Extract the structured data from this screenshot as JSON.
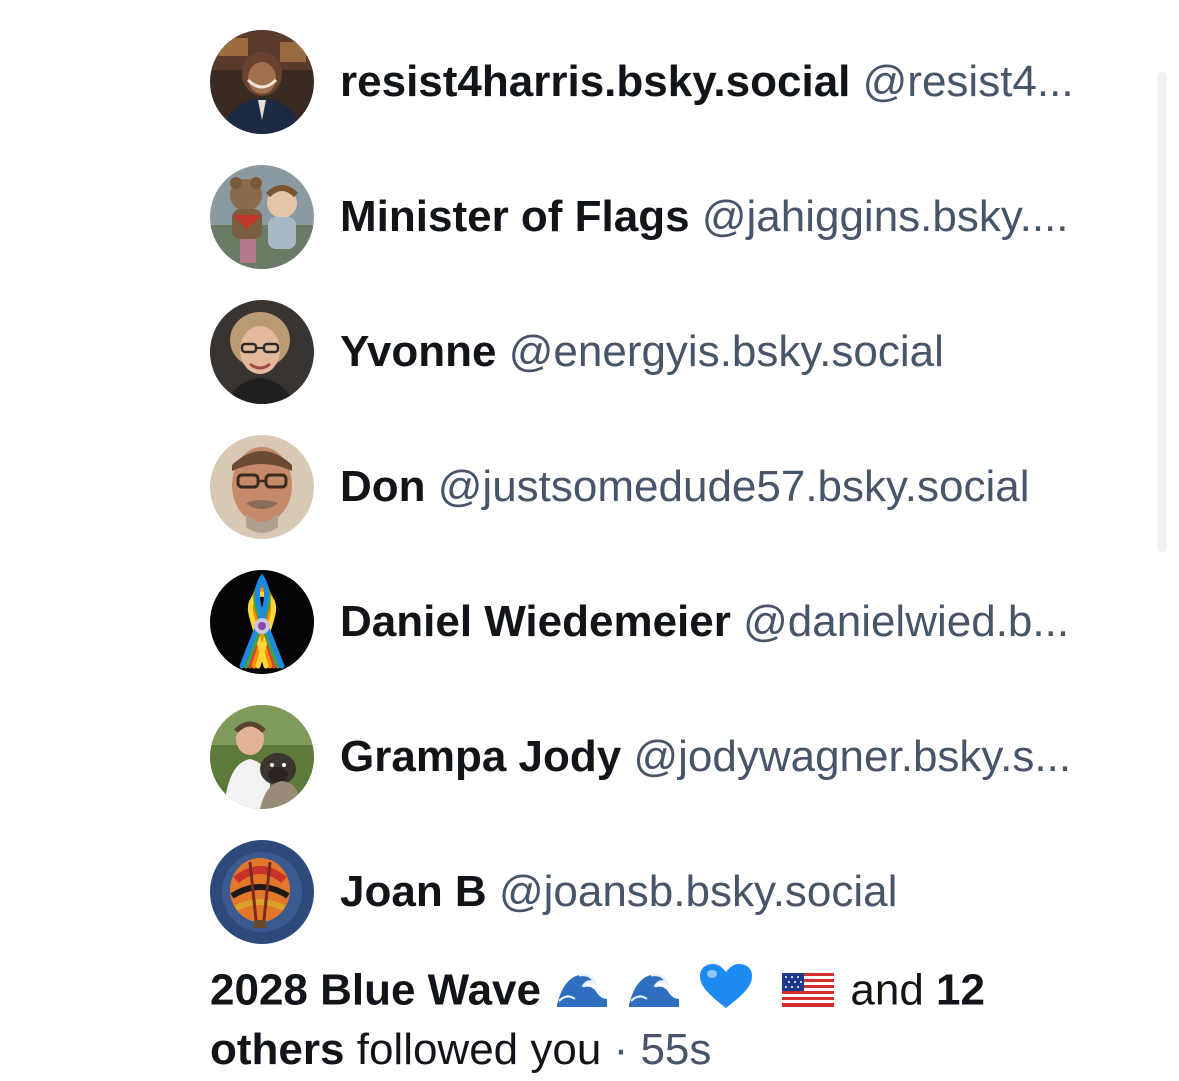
{
  "followers": [
    {
      "display_name": "resist4harris.bsky.social",
      "handle": "@resist4...",
      "avatar_icon": "portrait-woman-thank-you-avatar"
    },
    {
      "display_name": "Minister of Flags",
      "handle": "@jahiggins.bsky....",
      "avatar_icon": "plush-toys-avatar"
    },
    {
      "display_name": "Yvonne",
      "handle": "@energyis.bsky.social",
      "avatar_icon": "woman-glasses-avatar"
    },
    {
      "display_name": "Don",
      "handle": "@justsomedude57.bsky.social",
      "avatar_icon": "man-glasses-avatar"
    },
    {
      "display_name": "Daniel Wiedemeier",
      "handle": "@danielwied.b...",
      "avatar_icon": "rainbow-ribbon-avatar"
    },
    {
      "display_name": "Grampa Jody",
      "handle": "@jodywagner.bsky.s...",
      "avatar_icon": "man-with-dog-avatar"
    },
    {
      "display_name": "Joan B",
      "handle": "@joansb.bsky.social",
      "avatar_icon": "hot-air-balloon-avatar"
    }
  ],
  "summary": {
    "lead_name": "2028 Blue Wave",
    "lead_emojis": [
      "wave-emoji",
      "wave-emoji",
      "blue-heart-emoji",
      "us-flag-emoji"
    ],
    "connector": "and",
    "count": "12",
    "others": "others",
    "action": "followed you",
    "separator": "·",
    "time": "55s"
  },
  "colors": {
    "text_primary": "#111418",
    "text_muted": "#475569",
    "wave_blue": "#2f6fbf",
    "heart_blue": "#1d8bf1"
  }
}
